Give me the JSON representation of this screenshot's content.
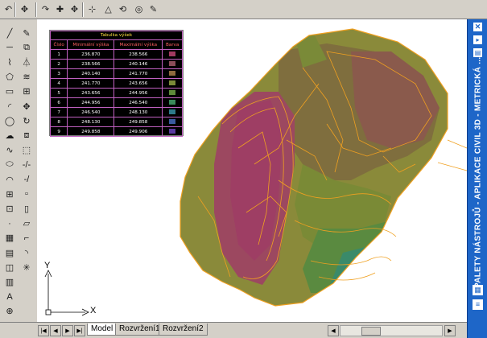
{
  "app": {
    "palette_title": "PALETY NÁSTROJŮ - APLIKACE CIVIL 3D - METRICKÁ ...",
    "palette_icons": [
      "close-icon",
      "autohide-icon",
      "properties-icon"
    ]
  },
  "toolbar_top": {
    "buttons": [
      {
        "name": "undo-icon",
        "glyph": "↶"
      },
      {
        "name": "pan-icon",
        "glyph": "✥"
      },
      {
        "name": "redo-icon",
        "glyph": "↷"
      },
      {
        "name": "point-add-icon",
        "glyph": "✚"
      },
      {
        "name": "point-move-icon",
        "glyph": "✥"
      },
      {
        "name": "point-insert-icon",
        "glyph": "⊹"
      },
      {
        "name": "triangle-edit-icon",
        "glyph": "△"
      },
      {
        "name": "surface-flip-icon",
        "glyph": "⟲"
      },
      {
        "name": "globe-icon",
        "glyph": "◎"
      },
      {
        "name": "brush-icon",
        "glyph": "✎"
      }
    ]
  },
  "draw_toolbar": {
    "col1": [
      "line-icon",
      "construction-line-icon",
      "polyline-icon",
      "polygon-icon",
      "rectangle-icon",
      "arc-icon",
      "circle-icon",
      "revcloud-icon",
      "spline-icon",
      "ellipse-icon",
      "ellipse-arc-icon",
      "insert-block-icon",
      "make-block-icon",
      "point-icon",
      "hatch-icon",
      "gradient-icon",
      "region-icon",
      "table-icon",
      "text-icon",
      "navigate-icon"
    ],
    "col2": [
      "erase-icon",
      "copy-icon",
      "mirror-icon",
      "offset-icon",
      "array-icon",
      "move-icon",
      "rotate-icon",
      "scale-icon",
      "stretch-icon",
      "trim-icon",
      "extend-icon",
      "break-point-icon",
      "break-icon",
      "join-icon",
      "chamfer-icon",
      "fillet-icon",
      "explode-icon"
    ]
  },
  "elevation_table": {
    "title": "Tabulka výšek",
    "headers": [
      "Číslo",
      "Minimální výška",
      "Maximální výška",
      "Barva"
    ],
    "rows": [
      {
        "n": "1",
        "min": "236.870",
        "max": "238.566",
        "color": "#a03a60"
      },
      {
        "n": "2",
        "min": "238.566",
        "max": "240.146",
        "color": "#8a4e58"
      },
      {
        "n": "3",
        "min": "240.140",
        "max": "241.770",
        "color": "#8e6a3c"
      },
      {
        "n": "4",
        "min": "241.770",
        "max": "243.656",
        "color": "#7a8a38"
      },
      {
        "n": "5",
        "min": "243.656",
        "max": "244.956",
        "color": "#5e8a3a"
      },
      {
        "n": "6",
        "min": "244.956",
        "max": "246.540",
        "color": "#3a8a5a"
      },
      {
        "n": "7",
        "min": "246.540",
        "max": "248.130",
        "color": "#2e7a8a"
      },
      {
        "n": "8",
        "min": "248.130",
        "max": "249.858",
        "color": "#3a5aa0"
      },
      {
        "n": "9",
        "min": "249.858",
        "max": "249.906",
        "color": "#5a3aa0"
      }
    ]
  },
  "ucs": {
    "x_label": "X",
    "y_label": "Y"
  },
  "layout_tabs": [
    {
      "label": "Model",
      "active": true
    },
    {
      "label": "Rozvržení1",
      "active": false
    },
    {
      "label": "Rozvržení2",
      "active": false
    }
  ]
}
